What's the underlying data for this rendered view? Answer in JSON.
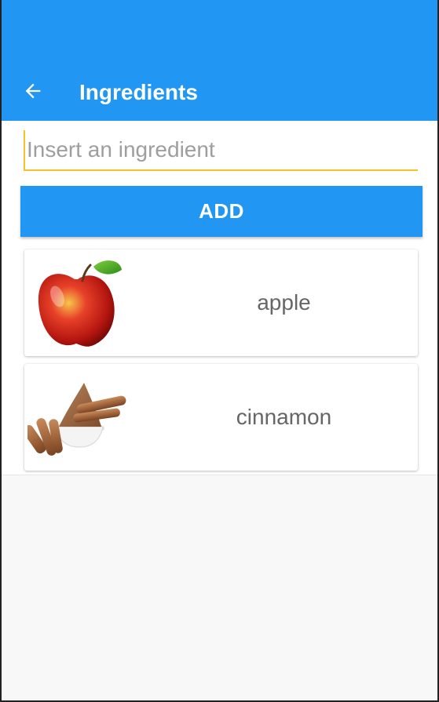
{
  "app_bar": {
    "title": "Ingredients",
    "back_icon": "arrow-left-icon",
    "color": "#2196f3"
  },
  "input": {
    "value": "",
    "placeholder": "Insert an ingredient",
    "accent_color": "#f5c227"
  },
  "add_button": {
    "label": "ADD"
  },
  "ingredients": [
    {
      "name": "apple",
      "image": "apple-image"
    },
    {
      "name": "cinnamon",
      "image": "cinnamon-image"
    }
  ]
}
